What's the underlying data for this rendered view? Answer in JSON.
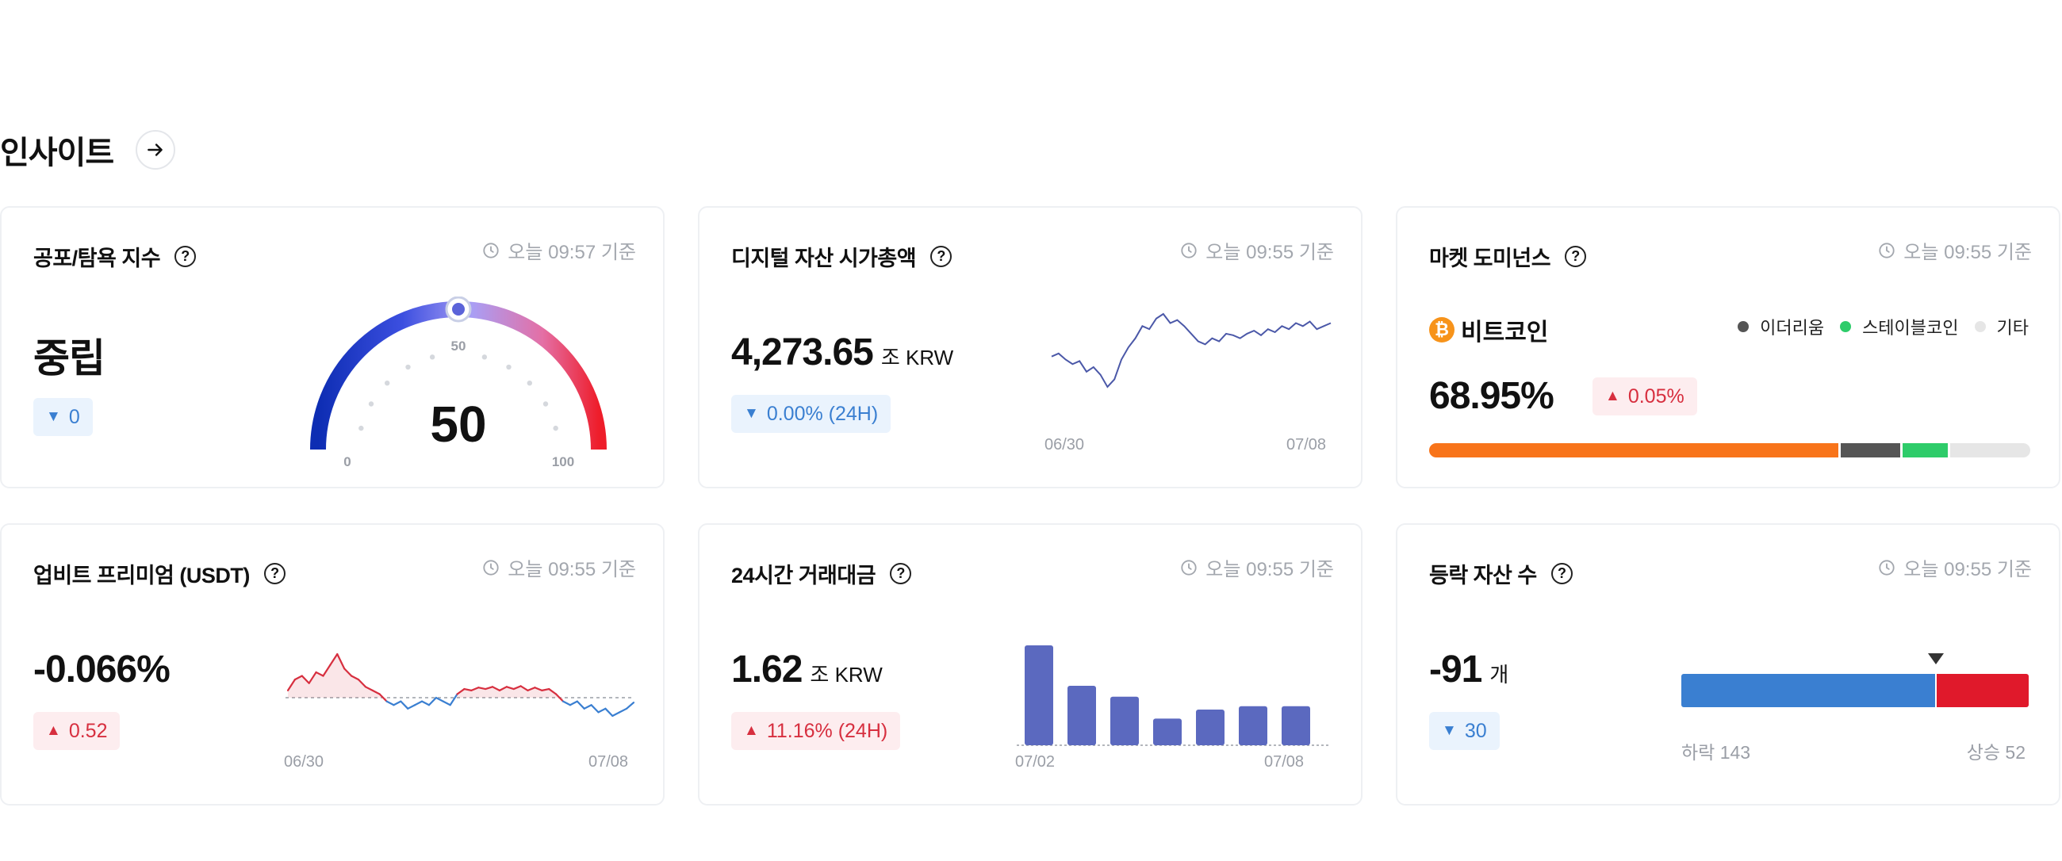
{
  "section": {
    "title": "인사이트"
  },
  "colors": {
    "blue": "#3a7fd1",
    "red": "#d72f3f",
    "bar": "#5b69bf",
    "btc": "#f8741a",
    "eth": "#555555",
    "stable": "#2ecc6a",
    "other": "#e6e6e6"
  },
  "fear_greed": {
    "title": "공포/탐욕 지수",
    "time": "오늘 09:57 기준",
    "status": "중립",
    "change": "0",
    "value": "50",
    "gauge_min": "0",
    "gauge_mid": "50",
    "gauge_max": "100"
  },
  "market_cap": {
    "title": "디지털 자산 시가총액",
    "time": "오늘 09:55 기준",
    "value": "4,273.65",
    "unit": "조 KRW",
    "change": "0.00% (24H)",
    "x_start": "06/30",
    "x_end": "07/08"
  },
  "dominance": {
    "title": "마켓 도미넌스",
    "time": "오늘 09:55 기준",
    "coin": "비트코인",
    "value": "68.95%",
    "change": "0.05%",
    "legend": [
      {
        "label": "이더리움"
      },
      {
        "label": "스테이블코인"
      },
      {
        "label": "기타"
      }
    ]
  },
  "premium": {
    "title": "업비트 프리미엄 (USDT)",
    "time": "오늘 09:55 기준",
    "value": "-0.066%",
    "change": "0.52",
    "x_start": "06/30",
    "x_end": "07/08"
  },
  "volume": {
    "title": "24시간 거래대금",
    "time": "오늘 09:55 기준",
    "value": "1.62",
    "unit": "조 KRW",
    "change": "11.16% (24H)",
    "x_start": "07/02",
    "x_end": "07/08"
  },
  "updown": {
    "title": "등락 자산 수",
    "time": "오늘 09:55 기준",
    "value": "-91",
    "unit": "개",
    "change": "30",
    "down_label": "하락 143",
    "up_label": "상승 52"
  },
  "chart_data": [
    {
      "type": "gauge",
      "title": "공포/탐욕 지수",
      "value": 50,
      "range": [
        0,
        100
      ],
      "tick_labels": [
        "0",
        "50",
        "100"
      ]
    },
    {
      "type": "line",
      "title": "디지털 자산 시가총액",
      "x_labels": [
        "06/30",
        "07/08"
      ],
      "values": [
        40,
        42,
        38,
        35,
        37,
        30,
        33,
        28,
        20,
        25,
        38,
        46,
        52,
        60,
        58,
        65,
        68,
        62,
        64,
        60,
        55,
        50,
        48,
        52,
        50,
        55,
        54,
        52,
        55,
        57,
        54,
        58,
        56,
        60,
        58,
        62,
        60,
        63,
        58,
        60,
        62
      ]
    },
    {
      "type": "bar",
      "title": "마켓 도미넌스",
      "unit": "%",
      "categories": [
        "비트코인",
        "이더리움",
        "스테이블코인",
        "기타"
      ],
      "values": [
        68.95,
        10.0,
        7.5,
        13.55
      ]
    },
    {
      "type": "line",
      "title": "업비트 프리미엄 (USDT)",
      "x_labels": [
        "06/30",
        "07/08"
      ],
      "baseline": 0,
      "values": [
        0.1,
        0.25,
        0.3,
        0.2,
        0.35,
        0.3,
        0.45,
        0.6,
        0.4,
        0.3,
        0.25,
        0.15,
        0.1,
        0.05,
        -0.05,
        -0.1,
        -0.05,
        -0.15,
        -0.1,
        -0.05,
        -0.1,
        0,
        -0.05,
        -0.1,
        0.05,
        0.12,
        0.1,
        0.14,
        0.12,
        0.15,
        0.1,
        0.15,
        0.12,
        0.16,
        0.1,
        0.14,
        0.1,
        0.12,
        0.05,
        -0.05,
        -0.1,
        -0.05,
        -0.15,
        -0.1,
        -0.2,
        -0.15,
        -0.25,
        -0.2,
        -0.15,
        -0.066
      ]
    },
    {
      "type": "bar",
      "title": "24시간 거래대금",
      "x_labels": [
        "07/02",
        "07/08"
      ],
      "values": [
        2.1,
        1.25,
        1.02,
        0.56,
        0.75,
        0.82,
        0.82
      ]
    },
    {
      "type": "bar",
      "title": "등락 자산 수",
      "categories": [
        "하락",
        "상승"
      ],
      "values": [
        143,
        52
      ]
    }
  ]
}
